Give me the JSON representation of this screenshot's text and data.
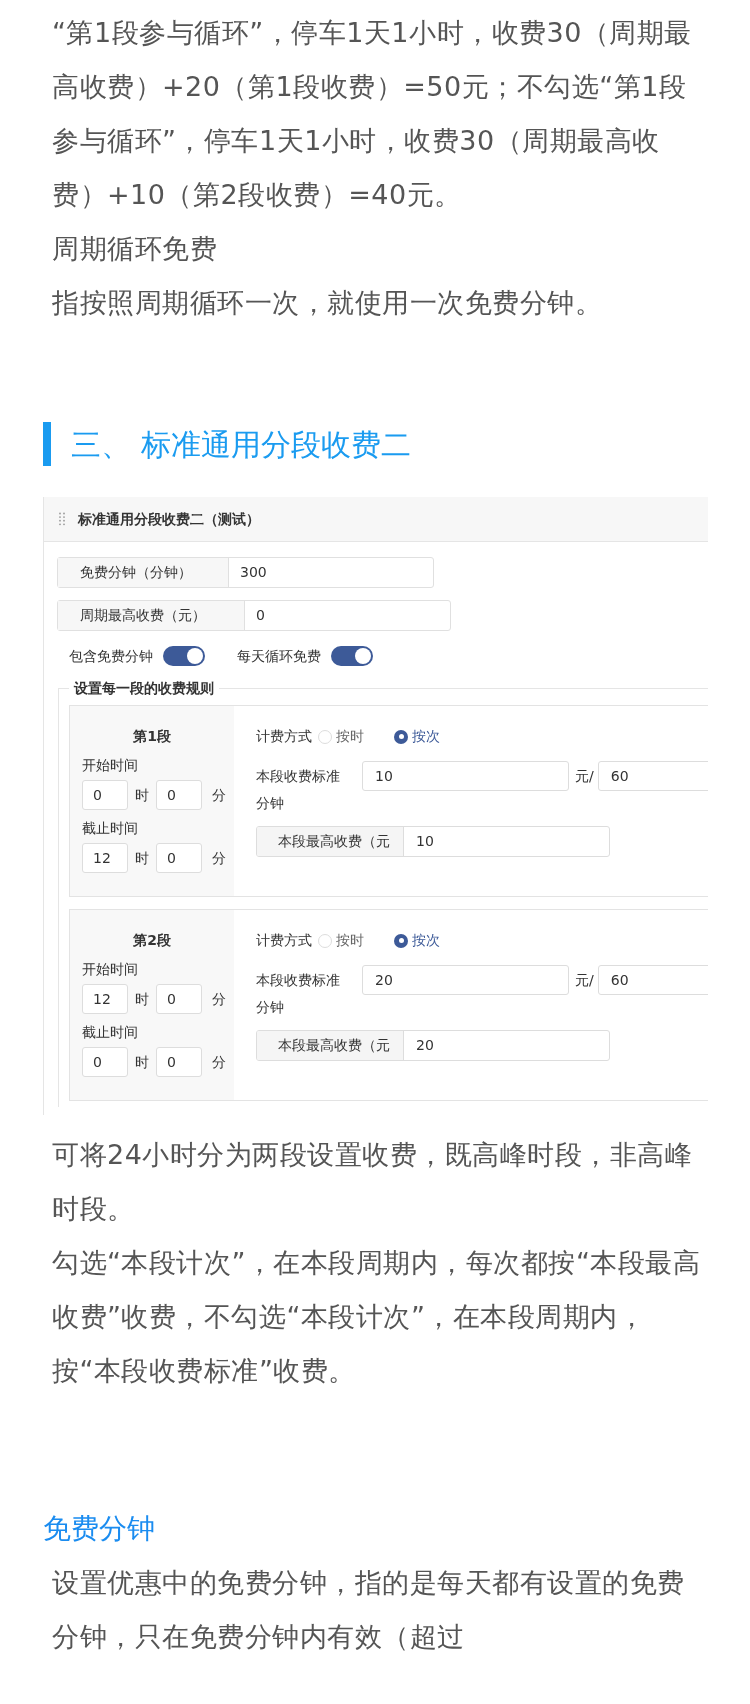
{
  "intro_paragraphs": [
    "“第1段参与循环”，停车1天1小时，收费30（周期最高收费）+20（第1段收费）=50元；不勾选“第1段参与循环”，停车1天1小时，收费30（周期最高收费）+10（第2段收费）=40元。",
    "周期循环免费",
    "指按照周期循环一次，就使用一次免费分钟。"
  ],
  "section_heading": "三、 标准通用分段收费二",
  "panel": {
    "title": "标准通用分段收费二（测试）",
    "fields": [
      {
        "label": "免费分钟（分钟）",
        "value": "300"
      },
      {
        "label": "周期最高收费（元）",
        "value": "0"
      }
    ],
    "toggles": [
      {
        "label": "包含免费分钟",
        "on": true
      },
      {
        "label": "每天循环免费",
        "on": true
      }
    ],
    "rules_title": "设置每一段的收费规则",
    "segments": [
      {
        "name": "第1段",
        "start": {
          "label": "开始时间",
          "hour": "0",
          "hour_unit": "时",
          "minute": "0",
          "minute_unit": "分"
        },
        "end": {
          "label": "截止时间",
          "hour": "12",
          "hour_unit": "时",
          "minute": "0",
          "minute_unit": "分"
        },
        "billing_label": "计费方式",
        "billing_options": [
          {
            "label": "按时",
            "selected": false
          },
          {
            "label": "按次",
            "selected": true
          }
        ],
        "standard_label": "本段收费标准",
        "standard_value": "10",
        "per_label": "元/",
        "per_value": "60",
        "minutes_label": "分钟",
        "max_label": "本段最高收费（元",
        "max_value": "10"
      },
      {
        "name": "第2段",
        "start": {
          "label": "开始时间",
          "hour": "12",
          "hour_unit": "时",
          "minute": "0",
          "minute_unit": "分"
        },
        "end": {
          "label": "截止时间",
          "hour": "0",
          "hour_unit": "时",
          "minute": "0",
          "minute_unit": "分"
        },
        "billing_label": "计费方式",
        "billing_options": [
          {
            "label": "按时",
            "selected": false
          },
          {
            "label": "按次",
            "selected": true
          }
        ],
        "standard_label": "本段收费标准",
        "standard_value": "20",
        "per_label": "元/",
        "per_value": "60",
        "minutes_label": "分钟",
        "max_label": "本段最高收费（元",
        "max_value": "20"
      }
    ]
  },
  "after_paragraphs": [
    "可将24小时分为两段设置收费，既高峰时段，非高峰时段。",
    "勾选“本段计次”，在本段周期内，每次都按“本段最高收费”收费，不勾选“本段计次”，在本段周期内，按“本段收费标准”收费。"
  ],
  "subheading": "免费分钟",
  "subheading_paragraph": "设置优惠中的免费分钟，指的是每天都有设置的免费分钟，只在免费分钟内有效（超过"
}
